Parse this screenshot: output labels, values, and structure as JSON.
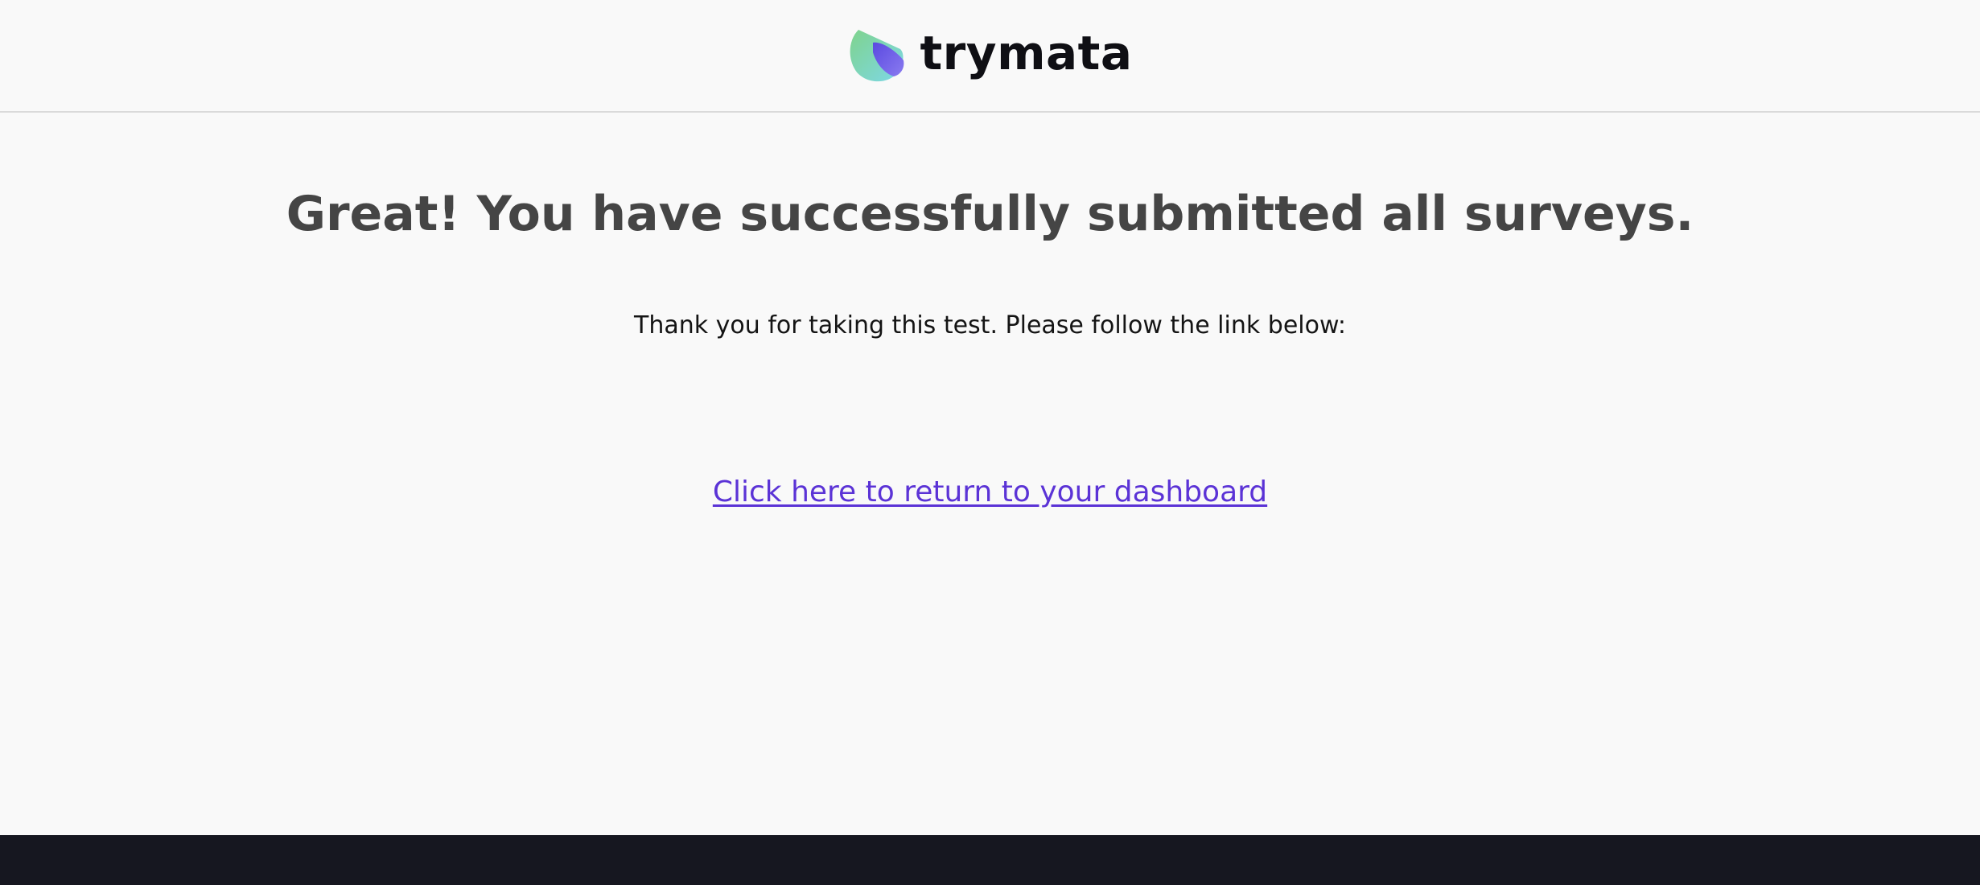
{
  "brand": {
    "name": "trymata",
    "logo_icon": "leaf-logo-icon",
    "logo_colors": [
      "#7fd38c",
      "#7dd8e8",
      "#5a49e0"
    ]
  },
  "main": {
    "title": "Great! You have successfully submitted all surveys.",
    "subtitle": "Thank you for taking this test. Please follow the link below:",
    "link_label": "Click here to return to your dashboard",
    "link_color": "#5b33d6"
  },
  "colors": {
    "background": "#f9f9f9",
    "footer": "#161720",
    "title": "#454545"
  }
}
